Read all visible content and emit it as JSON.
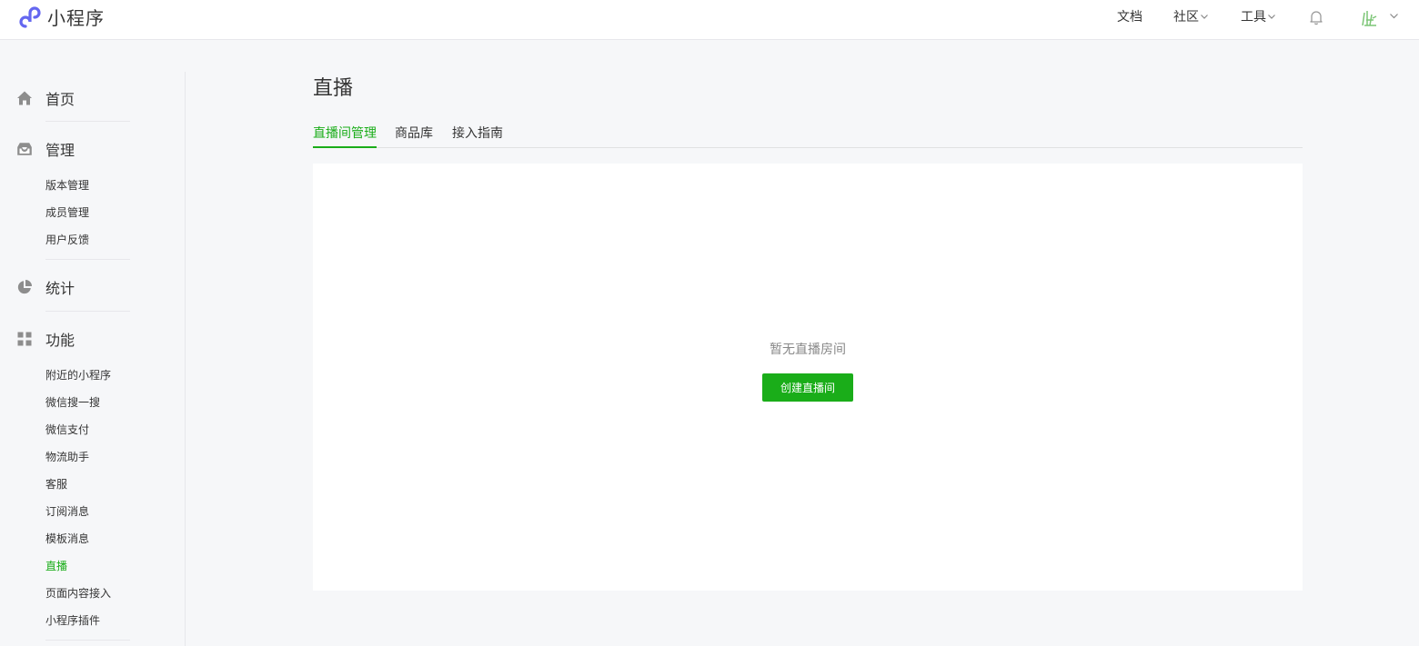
{
  "header": {
    "app_name": "小程序",
    "nav": {
      "docs": "文档",
      "community": "社区",
      "tools": "工具"
    }
  },
  "sidebar": {
    "sections": [
      {
        "label": "首页",
        "icon": "home-icon"
      },
      {
        "label": "管理",
        "icon": "inbox-icon",
        "items": [
          "版本管理",
          "成员管理",
          "用户反馈"
        ]
      },
      {
        "label": "统计",
        "icon": "pie-chart-icon"
      },
      {
        "label": "功能",
        "icon": "grid-icon",
        "items": [
          "附近的小程序",
          "微信搜一搜",
          "微信支付",
          "物流助手",
          "客服",
          "订阅消息",
          "模板消息",
          "直播",
          "页面内容接入",
          "小程序插件"
        ]
      }
    ],
    "active_item": "直播"
  },
  "main": {
    "title": "直播",
    "tabs": [
      "直播间管理",
      "商品库",
      "接入指南"
    ],
    "active_tab": "直播间管理",
    "empty_text": "暂无直播房间",
    "create_button": "创建直播间"
  },
  "colors": {
    "accent": "#1aad19",
    "logo": "#6467f0",
    "background": "#f6f7f9"
  }
}
